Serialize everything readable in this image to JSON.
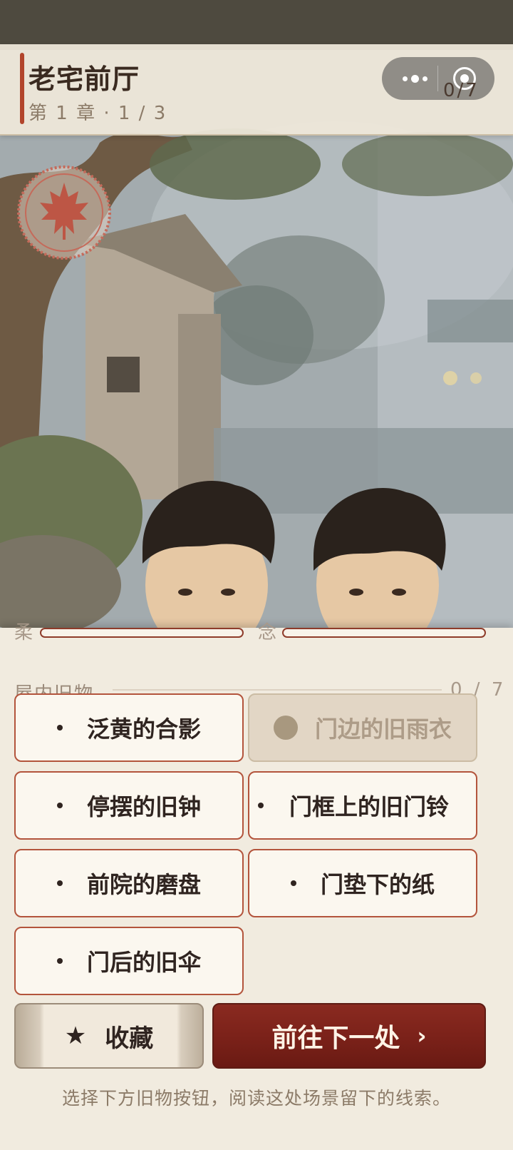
{
  "header": {
    "title": "老宅前厅",
    "subtitle": "第 1 章 · 1 / 3",
    "counter": "0/7",
    "more_icon": "more-dots-icon",
    "close_icon": "target-close-icon"
  },
  "seal": {
    "icon": "maple-leaf-icon"
  },
  "meters": {
    "left_label": "柔",
    "left_value": 0,
    "right_label": "念",
    "right_value": 0
  },
  "section": {
    "title": "屋内旧物",
    "count": "0 / 7"
  },
  "items": [
    {
      "label": "泛黄的合影",
      "state": "active"
    },
    {
      "label": "门边的旧雨衣",
      "state": "disabled"
    },
    {
      "label": "停摆的旧钟",
      "state": "active"
    },
    {
      "label": "门框上的旧门铃",
      "state": "active"
    },
    {
      "label": "前院的磨盘",
      "state": "active"
    },
    {
      "label": "门垫下的纸",
      "state": "active"
    },
    {
      "label": "门后的旧伞",
      "state": "active"
    }
  ],
  "actions": {
    "favorite_label": "收藏",
    "favorite_icon": "star-icon",
    "next_label": "前往下一处",
    "next_icon": "chevron-right-icon"
  },
  "hint": "选择下方旧物按钮，阅读这处场景留下的线索。",
  "colors": {
    "accent": "#b2452c",
    "primary_button": "#7a2119",
    "panel_bg": "#f1ebdf"
  }
}
